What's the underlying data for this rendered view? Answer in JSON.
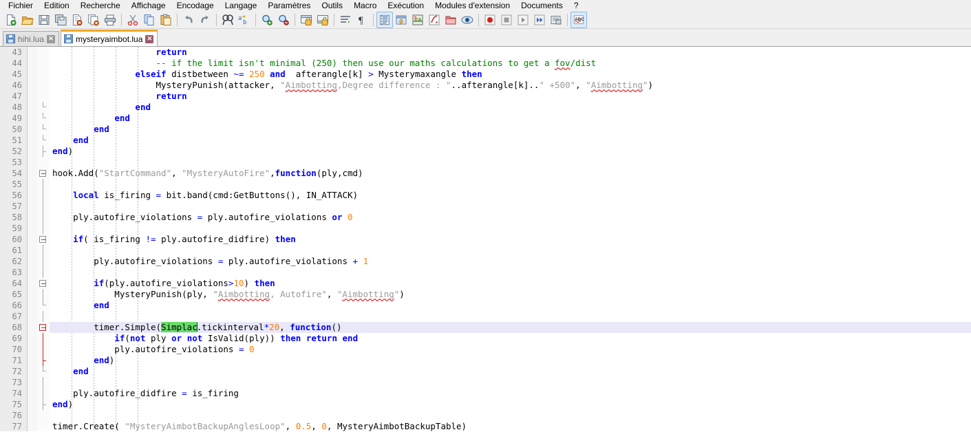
{
  "app": {
    "title": "Notepad++",
    "language": "fr"
  },
  "menubar": {
    "items": [
      {
        "label": "Fichier",
        "name": "menu-fichier"
      },
      {
        "label": "Edition",
        "name": "menu-edition"
      },
      {
        "label": "Recherche",
        "name": "menu-recherche"
      },
      {
        "label": "Affichage",
        "name": "menu-affichage"
      },
      {
        "label": "Encodage",
        "name": "menu-encodage"
      },
      {
        "label": "Langage",
        "name": "menu-langage"
      },
      {
        "label": "Paramètres",
        "name": "menu-parametres"
      },
      {
        "label": "Outils",
        "name": "menu-outils"
      },
      {
        "label": "Macro",
        "name": "menu-macro"
      },
      {
        "label": "Exécution",
        "name": "menu-execution"
      },
      {
        "label": "Modules d'extension",
        "name": "menu-modules-extension"
      },
      {
        "label": "Documents",
        "name": "menu-documents"
      },
      {
        "label": "?",
        "name": "menu-aide"
      }
    ]
  },
  "toolbar": {
    "icons": [
      "new-file-icon",
      "open-file-icon",
      "save-icon",
      "save-all-icon",
      "close-file-icon",
      "close-all-icon",
      "print-icon",
      "SEP",
      "cut-icon",
      "copy-icon",
      "paste-icon",
      "SEP",
      "undo-icon",
      "redo-icon",
      "SEP",
      "find-icon",
      "replace-icon",
      "SEP",
      "zoom-in-icon",
      "zoom-out-icon",
      "SEP",
      "sync-vertical-scroll-icon",
      "sync-horizontal-scroll-icon",
      "SEP",
      "word-wrap-icon",
      "show-all-characters-icon",
      "SEP",
      "indent-guide-icon",
      "user-defined-dialog-icon",
      "document-map-icon",
      "function-list-icon",
      "folder-workspace-icon",
      "monitoring-icon",
      "SEP",
      "record-macro-icon",
      "stop-recording-icon",
      "play-macro-icon",
      "run-macro-multiple-icon",
      "save-macro-icon",
      "SEP",
      "spell-check-icon"
    ]
  },
  "tabs": [
    {
      "label": "hihi.lua",
      "active": false,
      "name": "tab-hihi-lua"
    },
    {
      "label": "mysteryaimbot.lua",
      "active": true,
      "name": "tab-mysteryaimbot-lua"
    }
  ],
  "editor": {
    "current_line": 68,
    "selection_text": "Simplac",
    "first_line": 43,
    "last_line": 77,
    "lines": [
      {
        "n": 43,
        "text": "                    return"
      },
      {
        "n": 44,
        "text": "                    -- if the limit isn't minimal (250) then use our maths calculations to get a fov/dist"
      },
      {
        "n": 45,
        "text": "                elseif distbetween ~= 250 and  afterangle[k] > Mysterymaxangle then"
      },
      {
        "n": 46,
        "text": "                    MysteryPunish(attacker, \"Aimbotting,Degree difference : \"..afterangle[k]..\" +500\", \"Aimbotting\")"
      },
      {
        "n": 47,
        "text": "                    return"
      },
      {
        "n": 48,
        "text": "                end"
      },
      {
        "n": 49,
        "text": "            end"
      },
      {
        "n": 50,
        "text": "        end"
      },
      {
        "n": 51,
        "text": "    end"
      },
      {
        "n": 52,
        "text": "end)"
      },
      {
        "n": 53,
        "text": ""
      },
      {
        "n": 54,
        "text": "hook.Add(\"StartCommand\", \"MysteryAutoFire\",function(ply,cmd)"
      },
      {
        "n": 55,
        "text": ""
      },
      {
        "n": 56,
        "text": "    local is_firing = bit.band(cmd:GetButtons(), IN_ATTACK)"
      },
      {
        "n": 57,
        "text": ""
      },
      {
        "n": 58,
        "text": "    ply.autofire_violations = ply.autofire_violations or 0"
      },
      {
        "n": 59,
        "text": ""
      },
      {
        "n": 60,
        "text": "    if( is_firing != ply.autofire_didfire) then"
      },
      {
        "n": 61,
        "text": ""
      },
      {
        "n": 62,
        "text": "        ply.autofire_violations = ply.autofire_violations + 1"
      },
      {
        "n": 63,
        "text": ""
      },
      {
        "n": 64,
        "text": "        if(ply.autofire_violations>10) then"
      },
      {
        "n": 65,
        "text": "            MysteryPunish(ply, \"Aimbotting, Autofire\", \"Aimbotting\")"
      },
      {
        "n": 66,
        "text": "        end"
      },
      {
        "n": 67,
        "text": ""
      },
      {
        "n": 68,
        "text": "        timer.Simple(Simplac.tickinterval*20, function()"
      },
      {
        "n": 69,
        "text": "            if(not ply or not IsValid(ply)) then return end"
      },
      {
        "n": 70,
        "text": "            ply.autofire_violations = 0"
      },
      {
        "n": 71,
        "text": "        end)"
      },
      {
        "n": 72,
        "text": "    end"
      },
      {
        "n": 73,
        "text": ""
      },
      {
        "n": 74,
        "text": "    ply.autofire_didfire = is_firing"
      },
      {
        "n": 75,
        "text": "end)"
      },
      {
        "n": 76,
        "text": ""
      },
      {
        "n": 77,
        "text": "timer.Create( \"MysteryAimbotBackupAnglesLoop\", 0.5, 0, MysteryAimbotBackupTable)"
      }
    ]
  },
  "colors": {
    "keyword": "#0000ff",
    "number": "#ff8000",
    "string": "#9a9a9a",
    "comment": "#008000",
    "selection": "#66dd66",
    "current_line": "#e8e8f8",
    "gutter_bg": "#ececec",
    "gutter_fg": "#888888",
    "tab_active_accent": "#f5a623",
    "fold_active": "#cf1f1f"
  }
}
